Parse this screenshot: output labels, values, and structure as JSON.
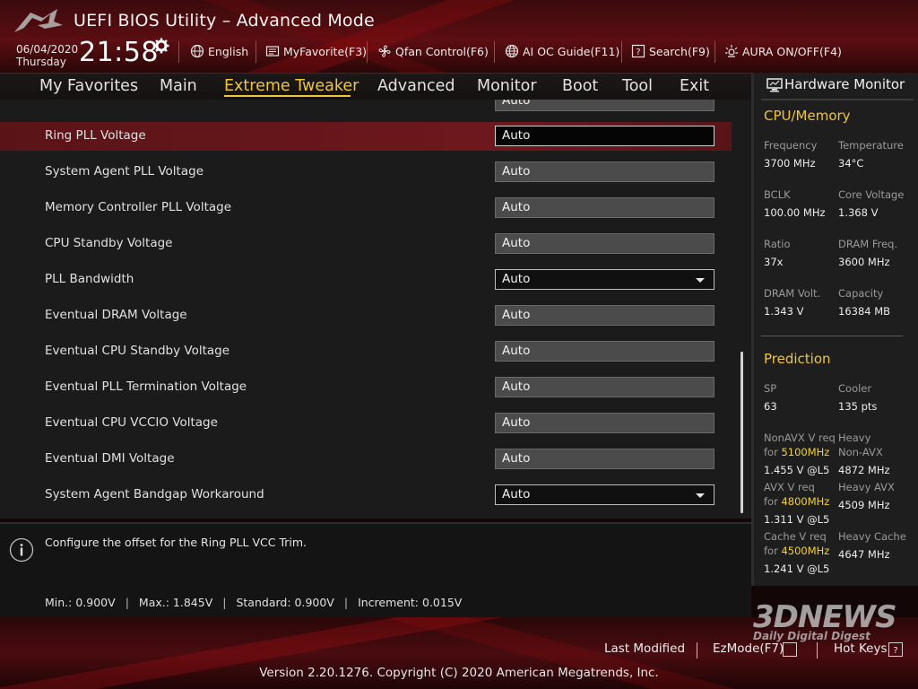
{
  "header": {
    "title": "UEFI BIOS Utility – Advanced Mode",
    "date": "06/04/2020",
    "weekday": "Thursday",
    "time": "21:58",
    "buttons": [
      {
        "label": "English",
        "icon": "globe-icon"
      },
      {
        "label": "MyFavorite(F3)",
        "icon": "favorite-icon"
      },
      {
        "label": "Qfan Control(F6)",
        "icon": "fan-icon"
      },
      {
        "label": "AI OC Guide(F11)",
        "icon": "globe-chip-icon"
      },
      {
        "label": "Search(F9)",
        "icon": "search-help-icon"
      },
      {
        "label": "AURA ON/OFF(F4)",
        "icon": "aura-icon"
      }
    ]
  },
  "menu": {
    "items": [
      "My Favorites",
      "Main",
      "Extreme Tweaker",
      "Advanced",
      "Monitor",
      "Boot",
      "Tool",
      "Exit"
    ],
    "active": "Extreme Tweaker"
  },
  "settings": {
    "partial_value": "Auto",
    "rows": [
      {
        "label": "Ring PLL Voltage",
        "value": "Auto"
      },
      {
        "label": "System Agent PLL Voltage",
        "value": "Auto"
      },
      {
        "label": "Memory Controller PLL Voltage",
        "value": "Auto"
      },
      {
        "label": "CPU Standby Voltage",
        "value": "Auto"
      },
      {
        "label": "PLL Bandwidth",
        "value": "Auto"
      },
      {
        "label": "Eventual DRAM Voltage",
        "value": "Auto"
      },
      {
        "label": "Eventual CPU Standby Voltage",
        "value": "Auto"
      },
      {
        "label": "Eventual PLL Termination Voltage",
        "value": "Auto"
      },
      {
        "label": "Eventual CPU VCCIO Voltage",
        "value": "Auto"
      },
      {
        "label": "Eventual DMI Voltage",
        "value": "Auto"
      },
      {
        "label": "System Agent Bandgap Workaround",
        "value": "Auto"
      }
    ]
  },
  "help": {
    "text": "Configure the offset for the Ring PLL VCC Trim.",
    "min": "Min.: 0.900V",
    "max": "Max.: 1.845V",
    "standard": "Standard: 0.900V",
    "increment": "Increment: 0.015V"
  },
  "hw_monitor": {
    "title": "Hardware Monitor",
    "cpu_memory": {
      "heading": "CPU/Memory",
      "frequency_label": "Frequency",
      "frequency": "3700 MHz",
      "temperature_label": "Temperature",
      "temperature": "34°C",
      "bclk_label": "BCLK",
      "bclk": "100.00 MHz",
      "core_voltage_label": "Core Voltage",
      "core_voltage": "1.368 V",
      "ratio_label": "Ratio",
      "ratio": "37x",
      "dram_freq_label": "DRAM Freq.",
      "dram_freq": "3600 MHz",
      "dram_volt_label": "DRAM Volt.",
      "dram_volt": "1.343 V",
      "capacity_label": "Capacity",
      "capacity": "16384 MB"
    },
    "prediction": {
      "heading": "Prediction",
      "sp_label": "SP",
      "sp": "63",
      "cooler_label": "Cooler",
      "cooler": "135 pts",
      "nonavx_label": "NonAVX V req",
      "nonavx_for": "for",
      "nonavx_freq": "5100MHz",
      "nonavx_value": "1.455 V @L5",
      "heavy_nonavx_label1": "Heavy",
      "heavy_nonavx_label2": "Non-AVX",
      "heavy_nonavx_value": "4872 MHz",
      "avx_label": "AVX V req",
      "avx_for": "for",
      "avx_freq": "4800MHz",
      "avx_value": "1.311 V @L5",
      "heavy_avx_label": "Heavy AVX",
      "heavy_avx_value": "4509 MHz",
      "cache_label": "Cache V req",
      "cache_for": "for",
      "cache_freq": "4500MHz",
      "cache_value": "1.241 V @L5",
      "heavy_cache_label": "Heavy Cache",
      "heavy_cache_value": "4647 MHz"
    }
  },
  "footer": {
    "last_modified": "Last Modified",
    "ezmode": "EzMode(F7)",
    "hotkeys": "Hot Keys",
    "copyright": "Version 2.20.1276. Copyright (C) 2020 American Megatrends, Inc.",
    "watermark_main": "3DNEWS",
    "watermark_sub": "Daily Digital Digest"
  },
  "colors": {
    "accent": "#f0c53a",
    "selected_row": "#6e181c",
    "header_red": "#5c0e12"
  }
}
